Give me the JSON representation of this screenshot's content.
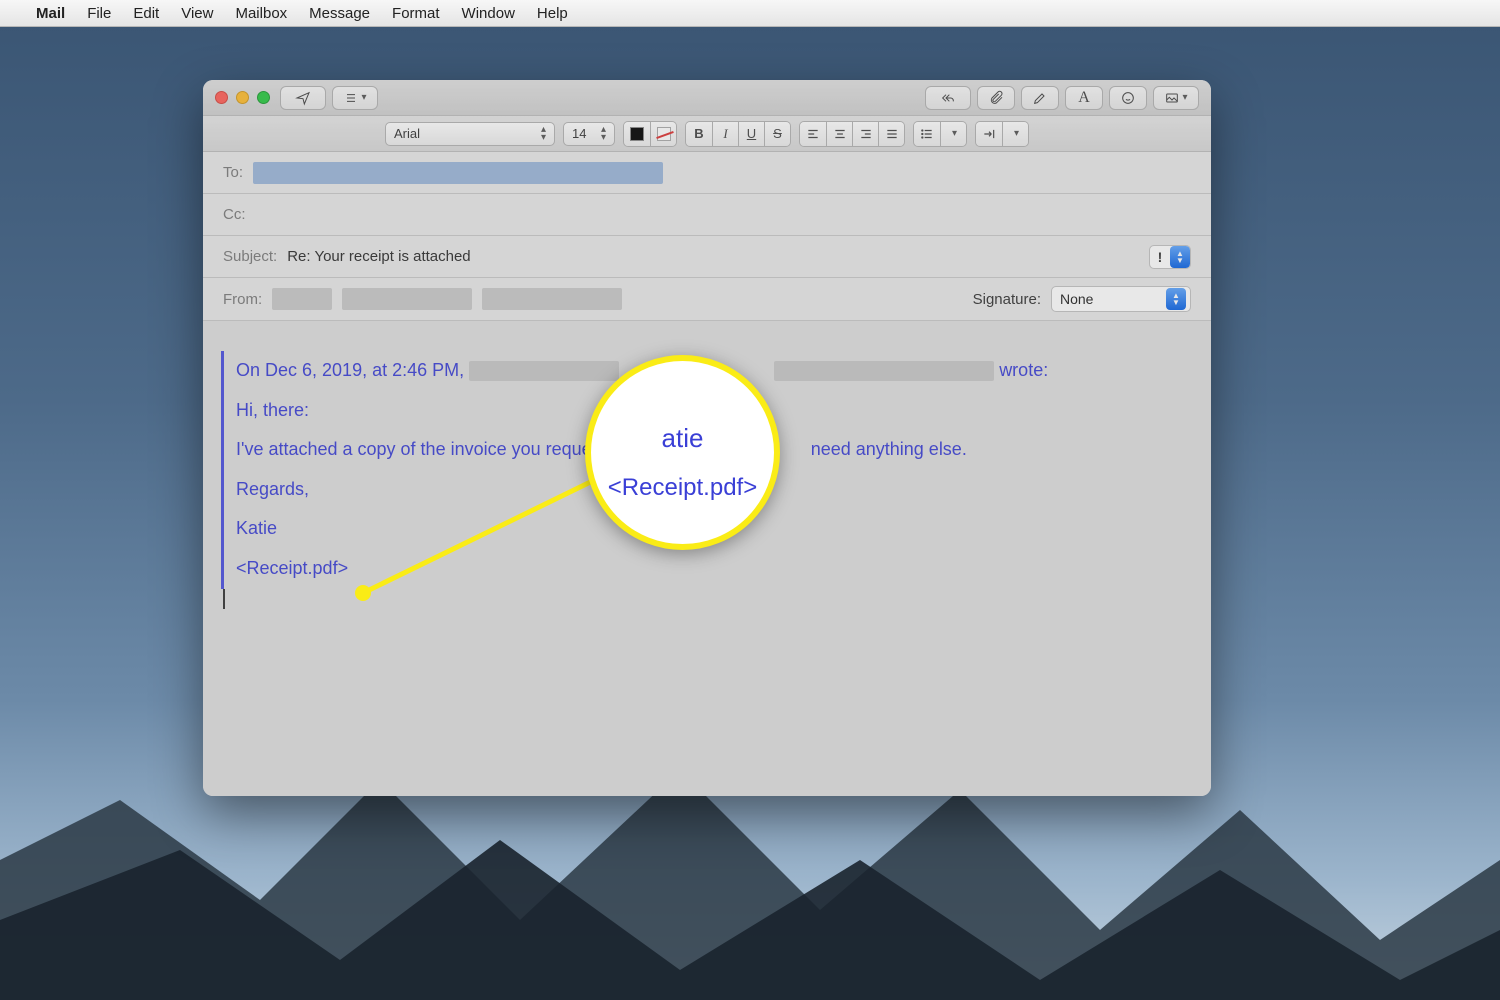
{
  "menubar": {
    "apple": "",
    "app": "Mail",
    "items": [
      "File",
      "Edit",
      "View",
      "Mailbox",
      "Message",
      "Format",
      "Window",
      "Help"
    ]
  },
  "toolbar": {
    "send": "send",
    "headers": "headers",
    "reply": "reply-all",
    "attach": "attach",
    "markup": "markup",
    "font": "font",
    "emoji": "emoji",
    "media": "media"
  },
  "format": {
    "font": "Arial",
    "size": "14",
    "bold": "B",
    "italic": "I",
    "underline": "U",
    "strike": "S"
  },
  "headers": {
    "to_label": "To:",
    "cc_label": "Cc:",
    "subject_label": "Subject:",
    "subject_value": "Re: Your receipt is attached",
    "from_label": "From:",
    "signature_label": "Signature:",
    "signature_value": "None",
    "priority_mark": "!"
  },
  "body": {
    "quote_date_prefix": "On Dec 6, 2019, at 2:46 PM,",
    "quote_wrote": "wrote:",
    "line_hi": "Hi, there:",
    "line_attached_a": "I've attached a copy of the invoice you reques",
    "line_attached_b": "need anything else.",
    "line_regards": "Regards,",
    "line_name": "Katie",
    "line_attachment": "<Receipt.pdf>"
  },
  "callout": {
    "frag_top": "atie",
    "frag_main": "<Receipt.pdf>"
  }
}
